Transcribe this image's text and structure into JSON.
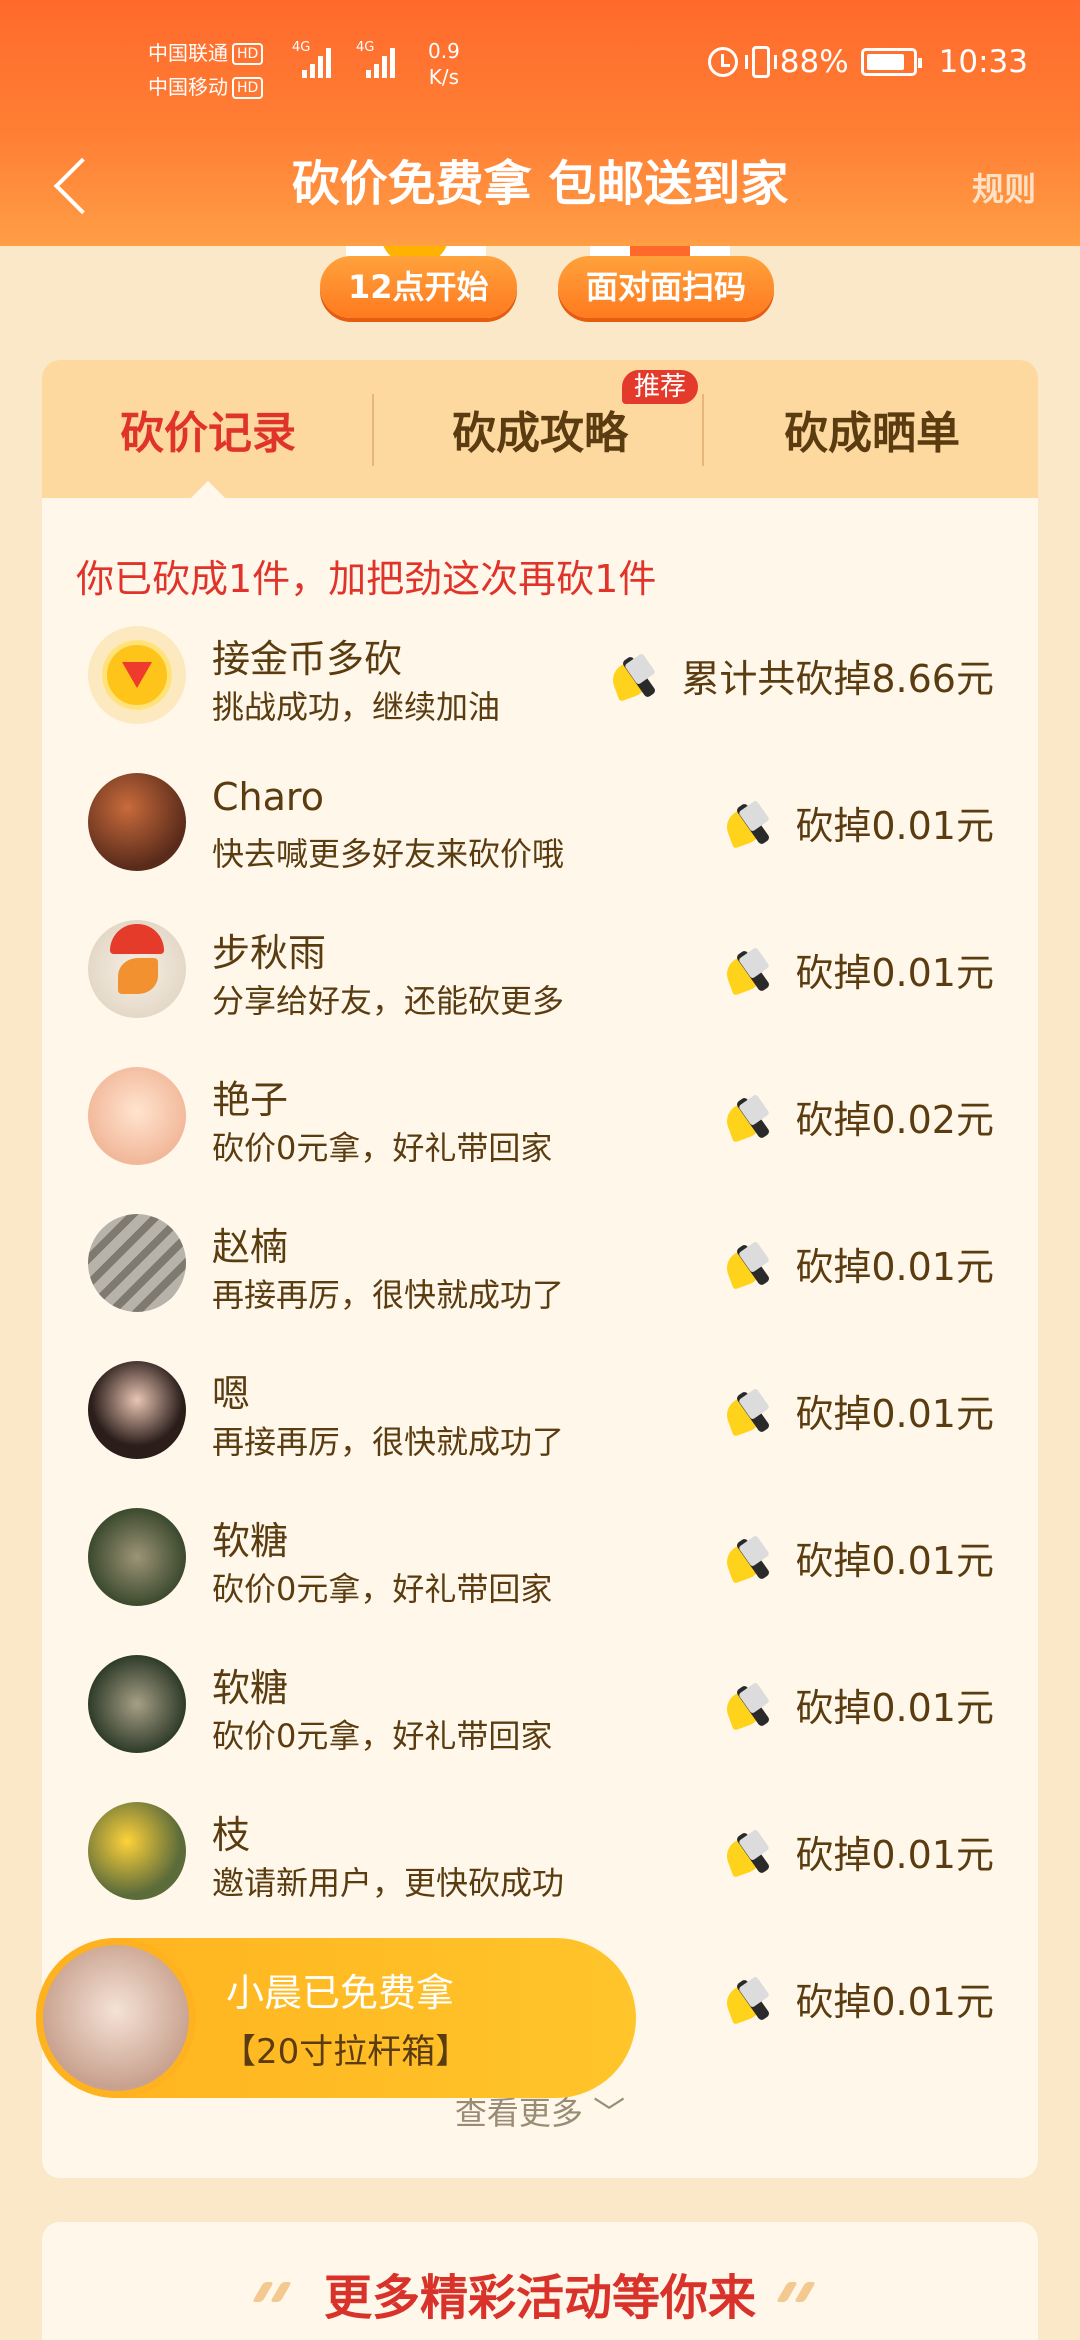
{
  "status_bar": {
    "carrier1": "中国联通",
    "carrier2": "中国移动",
    "hd": "HD",
    "net_type": "4G",
    "speed_value": "0.9",
    "speed_unit": "K/s",
    "battery": "88%",
    "time": "10:33"
  },
  "nav": {
    "title": "砍价免费拿 包邮送到家",
    "rules": "规则"
  },
  "quick_buttons": [
    "12点开始",
    "面对面扫码"
  ],
  "tabs": [
    {
      "label": "砍价记录"
    },
    {
      "label": "砍成攻略",
      "badge": "推荐"
    },
    {
      "label": "砍成晒单"
    }
  ],
  "summary": "你已砍成1件，加把劲这次再砍1件",
  "records": [
    {
      "name": "接金币多砍",
      "message": "挑战成功，继续加油",
      "amount": "累计共砍掉8.66元"
    },
    {
      "name": "Charo",
      "message": "快去喊更多好友来砍价哦",
      "amount": "砍掉0.01元"
    },
    {
      "name": "步秋雨",
      "message": "分享给好友，还能砍更多",
      "amount": "砍掉0.01元"
    },
    {
      "name": "艳子",
      "message": "砍价0元拿，好礼带回家",
      "amount": "砍掉0.02元"
    },
    {
      "name": "赵楠",
      "message": "再接再厉，很快就成功了",
      "amount": "砍掉0.01元"
    },
    {
      "name": "嗯",
      "message": "再接再厉，很快就成功了",
      "amount": "砍掉0.01元"
    },
    {
      "name": "软糖",
      "message": "砍价0元拿，好礼带回家",
      "amount": "砍掉0.01元"
    },
    {
      "name": "软糖",
      "message": "砍价0元拿，好礼带回家",
      "amount": "砍掉0.01元"
    },
    {
      "name": "枝",
      "message": "邀请新用户，更快砍成功",
      "amount": "砍掉0.01元"
    },
    {
      "name": "",
      "message": "",
      "amount": "砍掉0.01元"
    }
  ],
  "view_more": "查看更多",
  "float_banner": {
    "line1": "小晨已免费拿",
    "line2": "【20寸拉杆箱】"
  },
  "more_title": "更多精彩活动等你来",
  "colors": {
    "header": "#ff6a2b",
    "accent_red": "#e0342a",
    "tab_bg": "#fdd9a0",
    "banner": "#ffb21f"
  }
}
